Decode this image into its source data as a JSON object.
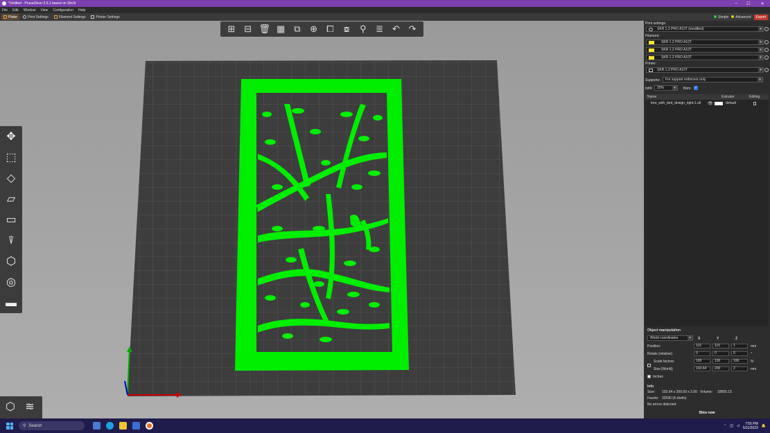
{
  "window": {
    "title": "*Untitled - PrusaSlicer-2.6.1 based on Slic3r",
    "minimize": "–",
    "maximize": "☐",
    "close": "✕"
  },
  "menu": [
    "File",
    "Edit",
    "Window",
    "View",
    "Configuration",
    "Help"
  ],
  "tabs": [
    "Plater",
    "Print Settings",
    "Filament Settings",
    "Printer Settings"
  ],
  "mode": {
    "simple": "Simple",
    "advanced": "Advanced",
    "export": "Export"
  },
  "colors": {
    "accent": "#ed6b21",
    "model": "#00ff00",
    "title_bar": "#7b3fb0",
    "bed": "#3f3f3f"
  },
  "sidebar": {
    "print_settings_label": "Print settings:",
    "print_profile": "SKR 1.2 PRO A10T (modified)",
    "filament_label": "Filament:",
    "filaments": [
      "SKR 1.2 PRO A10T",
      "SKR 1.2 PRO A10T",
      "SKR 1.2 PRO A10T"
    ],
    "printer_label": "Printer:",
    "printer_profile": "SKR 1.2 PRO A10T",
    "supports_label": "Supports:",
    "supports_value": "For support enforcers only",
    "infill_label": "Infill:",
    "infill_value": "20%",
    "brim_label": "Brim:",
    "list_headers": {
      "name": "Name",
      "extruder": "Extruder",
      "editing": "Editing"
    },
    "object_name": "tree_with_bird_design_right-1.stl",
    "object_extruder": "default"
  },
  "object_manipulation": {
    "title": "Object manipulation",
    "coord_system": "World coordinates",
    "axes": [
      "X",
      "Y",
      "Z"
    ],
    "position_label": "Position:",
    "position": [
      "115",
      "115",
      "1"
    ],
    "position_unit": "mm",
    "rotate_label": "Rotate (relative):",
    "rotate": [
      "0",
      "0",
      "0"
    ],
    "rotate_unit": "°",
    "scale_label": "Scale factors:",
    "scale": [
      "100",
      "100",
      "100"
    ],
    "scale_unit": "%",
    "size_label": "Size [World]:",
    "size": [
      "103.64",
      "200",
      "2"
    ],
    "size_unit": "mm",
    "inches_label": "Inches"
  },
  "info": {
    "title": "Info",
    "size_label": "Size:",
    "size_value": "103.64 x 200.00 x 2.00",
    "volume_label": "Volume:",
    "volume_value": "18955.15",
    "facets_label": "Facets:",
    "facets_value": "32596 (8 shells)",
    "status": "No errors detected"
  },
  "slice_button": "Slice now",
  "taskbar": {
    "search_placeholder": "Search",
    "time": "7:55 PM",
    "date": "5/11/2023"
  }
}
